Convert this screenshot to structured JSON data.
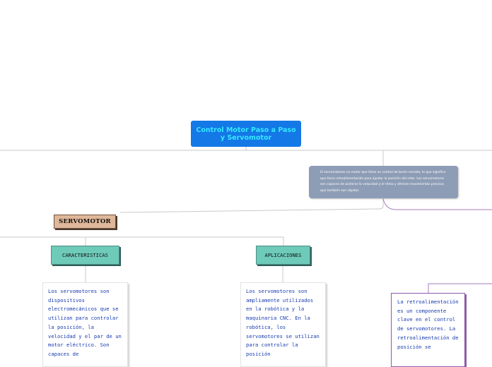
{
  "nodes": {
    "root": "Control Motor Paso a Paso y Servomotor",
    "note": "El servomotores un motor que tiene un control de bucle cerrado, lo que significa que tiene retroalimentación para ajustar la posición del rotor. Los servomotores son capaces de acelerar la velocidad y el ritmo y ofrecen movimientos precisos que también son rápidos",
    "servomotor": "SERVOMOTOR",
    "caracteristicas": "CARACTERISTICAS",
    "aplicaciones": "APLICACIONES",
    "caracteristicas_text": "Los servomotores son dispositivos electromecánicos que se utilizan para controlar la posición, la velocidad y el par de un motor eléctrico. Son capaces de",
    "aplicaciones_text": "Los servomotores son ampliamente utilizados en la robótica y la maquinaria CNC. En la robótica, los servomotores se utilizan para controlar la posición",
    "retro_text": "La retroalimentación es un componente clave en el control de servomotores. La retroalimentación de posición se"
  },
  "colors": {
    "root_bg": "#1478e6",
    "root_text": "#34e8ff",
    "note_bg": "#8e9db6",
    "servo_bg": "#dfb79a",
    "teal_bg": "#6ecab9",
    "body_text": "#173bb0",
    "purple_line": "#8d5aa8"
  }
}
